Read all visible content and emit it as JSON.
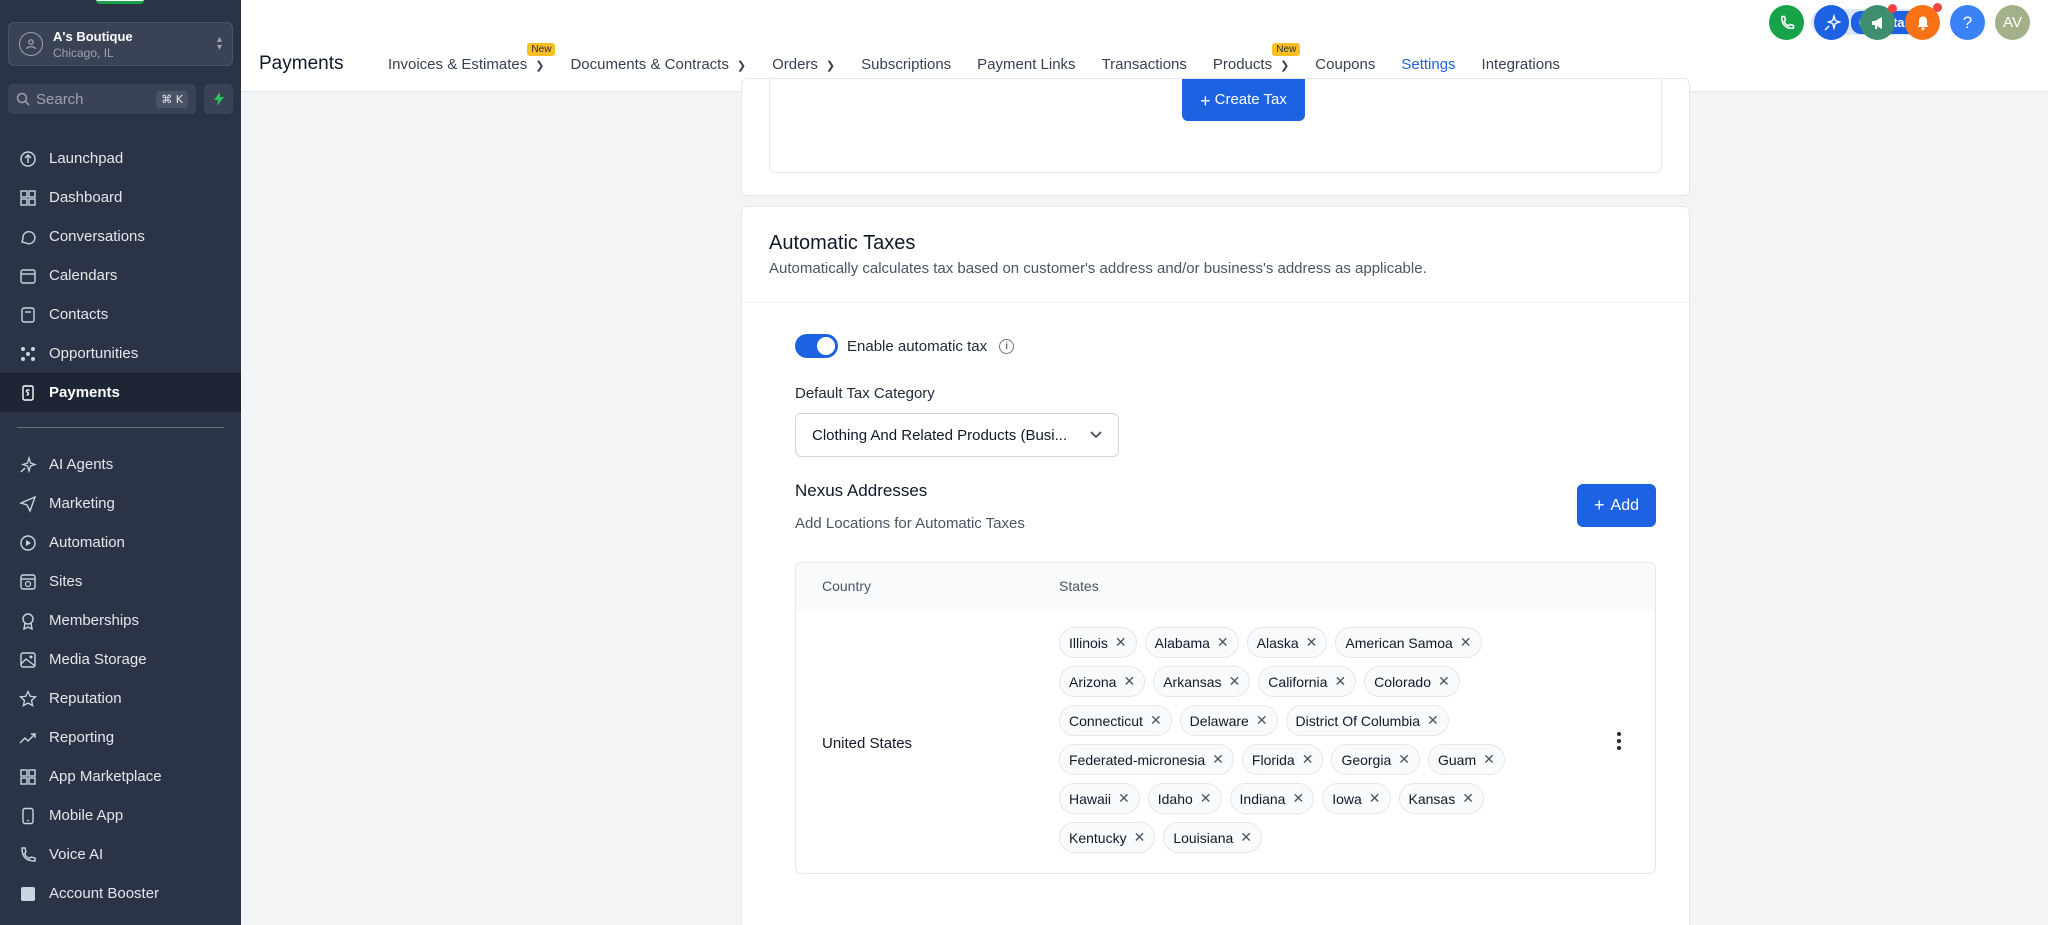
{
  "account": {
    "name": "A's Boutique",
    "location": "Chicago, IL"
  },
  "search": {
    "placeholder": "Search",
    "shortcut": "⌘ K"
  },
  "sidebar": {
    "items": [
      {
        "label": "Launchpad",
        "icon": "rocket-icon"
      },
      {
        "label": "Dashboard",
        "icon": "grid-icon"
      },
      {
        "label": "Conversations",
        "icon": "chat-icon"
      },
      {
        "label": "Calendars",
        "icon": "calendar-icon"
      },
      {
        "label": "Contacts",
        "icon": "contacts-icon"
      },
      {
        "label": "Opportunities",
        "icon": "opportunities-icon"
      },
      {
        "label": "Payments",
        "icon": "payments-icon",
        "active": true
      }
    ],
    "items2": [
      {
        "label": "AI Agents",
        "icon": "sparkle-icon"
      },
      {
        "label": "Marketing",
        "icon": "send-icon"
      },
      {
        "label": "Automation",
        "icon": "automation-icon"
      },
      {
        "label": "Sites",
        "icon": "sites-icon"
      },
      {
        "label": "Memberships",
        "icon": "membership-icon"
      },
      {
        "label": "Media Storage",
        "icon": "image-icon"
      },
      {
        "label": "Reputation",
        "icon": "star-icon"
      },
      {
        "label": "Reporting",
        "icon": "trend-icon"
      },
      {
        "label": "App Marketplace",
        "icon": "apps-icon"
      },
      {
        "label": "Mobile App",
        "icon": "phone-icon"
      },
      {
        "label": "Voice AI",
        "icon": "voice-icon"
      },
      {
        "label": "Account Booster",
        "icon": "booster-icon"
      }
    ]
  },
  "header": {
    "title": "Payments",
    "tabs": [
      {
        "label": "Invoices & Estimates",
        "dropdown": true,
        "badge": "New"
      },
      {
        "label": "Documents & Contracts",
        "dropdown": true
      },
      {
        "label": "Orders",
        "dropdown": true
      },
      {
        "label": "Subscriptions"
      },
      {
        "label": "Payment Links"
      },
      {
        "label": "Transactions"
      },
      {
        "label": "Products",
        "dropdown": true,
        "badge": "New"
      },
      {
        "label": "Coupons"
      },
      {
        "label": "Settings",
        "active": true
      },
      {
        "label": "Integrations"
      }
    ],
    "get_started": "Get Started",
    "avatar_initials": "AV",
    "help": "?"
  },
  "tax": {
    "create_label": "Create Tax"
  },
  "auto_tax": {
    "title": "Automatic Taxes",
    "description": "Automatically calculates tax based on customer's address and/or business's address as applicable.",
    "toggle_label": "Enable automatic tax",
    "toggle_on": true,
    "category_label": "Default Tax Category",
    "category_value": "Clothing And Related Products (Busi...",
    "nexus_title": "Nexus Addresses",
    "nexus_subtitle": "Add Locations for Automatic Taxes",
    "add_label": "Add",
    "table": {
      "headers": [
        "Country",
        "States"
      ],
      "country": "United States",
      "states": [
        "Illinois",
        "Alabama",
        "Alaska",
        "American Samoa",
        "Arizona",
        "Arkansas",
        "California",
        "Colorado",
        "Connecticut",
        "Delaware",
        "District Of Columbia",
        "Federated-micronesia",
        "Florida",
        "Georgia",
        "Guam",
        "Hawaii",
        "Idaho",
        "Indiana",
        "Iowa",
        "Kansas",
        "Kentucky",
        "Louisiana"
      ]
    }
  },
  "colors": {
    "primary": "#1d62e3",
    "sidebar": "#2b3446",
    "badge": "#fbbf24"
  }
}
